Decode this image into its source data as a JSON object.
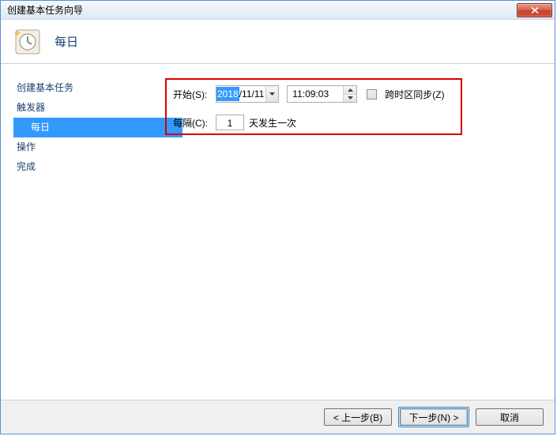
{
  "window": {
    "title": "创建基本任务向导"
  },
  "header": {
    "title": "每日"
  },
  "nav": {
    "items": [
      {
        "label": "创建基本任务",
        "selected": false,
        "sub": false
      },
      {
        "label": "触发器",
        "selected": false,
        "sub": false
      },
      {
        "label": "每日",
        "selected": true,
        "sub": true
      },
      {
        "label": "操作",
        "selected": false,
        "sub": false
      },
      {
        "label": "完成",
        "selected": false,
        "sub": false
      }
    ]
  },
  "form": {
    "start_label": "开始(S):",
    "date_selected_part": "2018",
    "date_rest_part": "/11/11",
    "time_value": "11:09:03",
    "tz_sync_label": "跨时区同步(Z)",
    "tz_sync_checked": false,
    "interval_label": "每隔(C):",
    "interval_value": "1",
    "interval_suffix": "天发生一次"
  },
  "footer": {
    "back": "< 上一步(B)",
    "next": "下一步(N) >",
    "cancel": "取消"
  }
}
